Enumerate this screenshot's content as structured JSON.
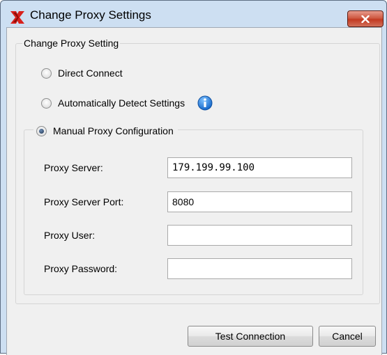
{
  "window": {
    "title": "Change Proxy Settings",
    "close_label": "×",
    "accent_color": "#cddff2",
    "app_icon": "xilinx-logo-icon"
  },
  "group": {
    "legend": "Change Proxy Setting"
  },
  "options": [
    {
      "label": "Direct Connect",
      "selected": false
    },
    {
      "label": "Automatically Detect Settings",
      "selected": false,
      "icon": "info-icon"
    },
    {
      "label": "Manual Proxy Configuration",
      "selected": true
    }
  ],
  "fields": [
    {
      "label": "Proxy Server:",
      "value": "179.199.99.100",
      "placeholder": ""
    },
    {
      "label": "Proxy Server Port:",
      "value": "8080",
      "placeholder": ""
    },
    {
      "label": "Proxy User:",
      "value": "",
      "placeholder": ""
    },
    {
      "label": "Proxy Password:",
      "value": "",
      "placeholder": ""
    }
  ],
  "buttons": {
    "test_label": "Test Connection",
    "cancel_label": "Cancel"
  }
}
